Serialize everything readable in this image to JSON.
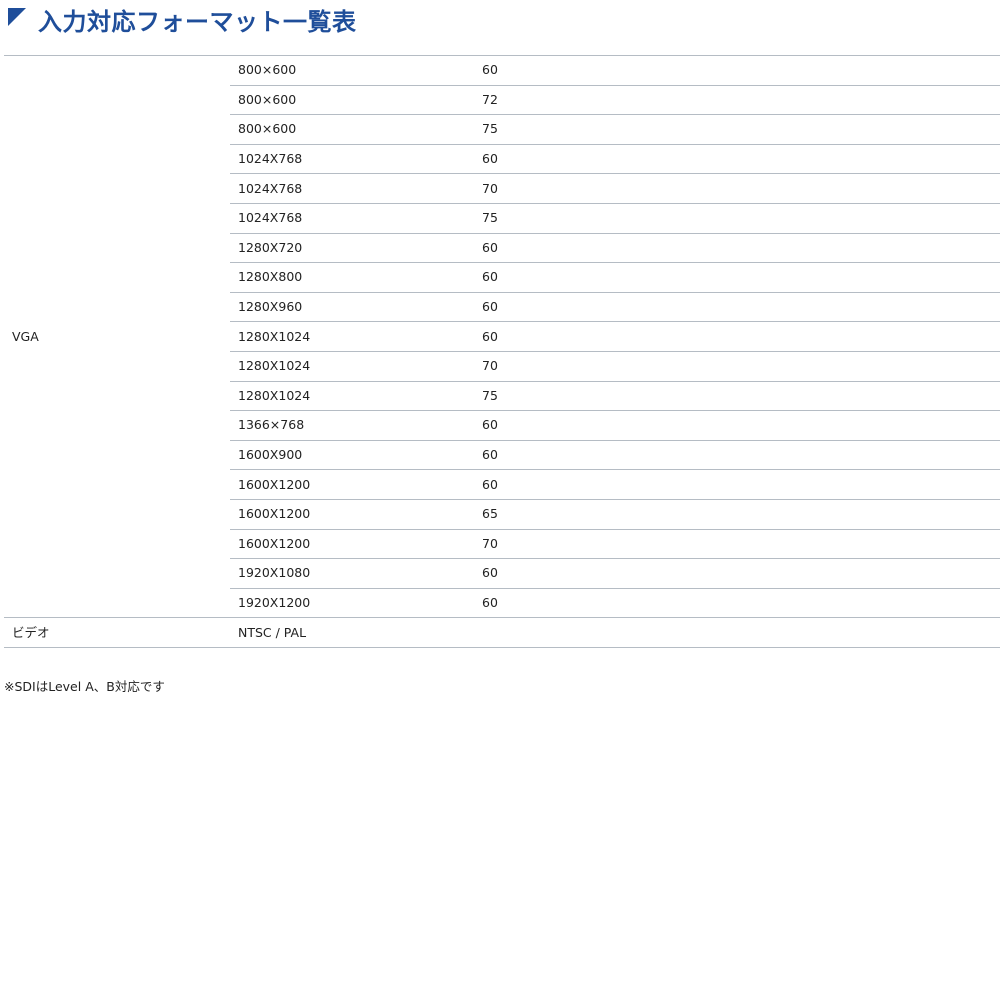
{
  "heading": {
    "title": "入力対応フォーマット一覧表",
    "accent_color": "#1f4e9a",
    "icon": "triangle-marker-icon"
  },
  "table": {
    "groups": [
      {
        "name": "VGA",
        "rows": [
          {
            "resolution": "800×600",
            "rate": "60"
          },
          {
            "resolution": "800×600",
            "rate": "72"
          },
          {
            "resolution": "800×600",
            "rate": "75"
          },
          {
            "resolution": "1024X768",
            "rate": "60"
          },
          {
            "resolution": "1024X768",
            "rate": "70"
          },
          {
            "resolution": "1024X768",
            "rate": "75"
          },
          {
            "resolution": "1280X720",
            "rate": "60"
          },
          {
            "resolution": "1280X800",
            "rate": "60"
          },
          {
            "resolution": "1280X960",
            "rate": "60"
          },
          {
            "resolution": "1280X1024",
            "rate": "60"
          },
          {
            "resolution": "1280X1024",
            "rate": "70"
          },
          {
            "resolution": "1280X1024",
            "rate": "75"
          },
          {
            "resolution": "1366×768",
            "rate": "60"
          },
          {
            "resolution": "1600X900",
            "rate": "60"
          },
          {
            "resolution": "1600X1200",
            "rate": "60"
          },
          {
            "resolution": "1600X1200",
            "rate": "65"
          },
          {
            "resolution": "1600X1200",
            "rate": "70"
          },
          {
            "resolution": "1920X1080",
            "rate": "60"
          },
          {
            "resolution": "1920X1200",
            "rate": "60"
          }
        ]
      },
      {
        "name": "ビデオ",
        "rows": [
          {
            "resolution": "NTSC / PAL",
            "rate": ""
          }
        ]
      }
    ],
    "border_color": "#b5bcc4"
  },
  "note": "※SDIはLevel A、B対応です"
}
